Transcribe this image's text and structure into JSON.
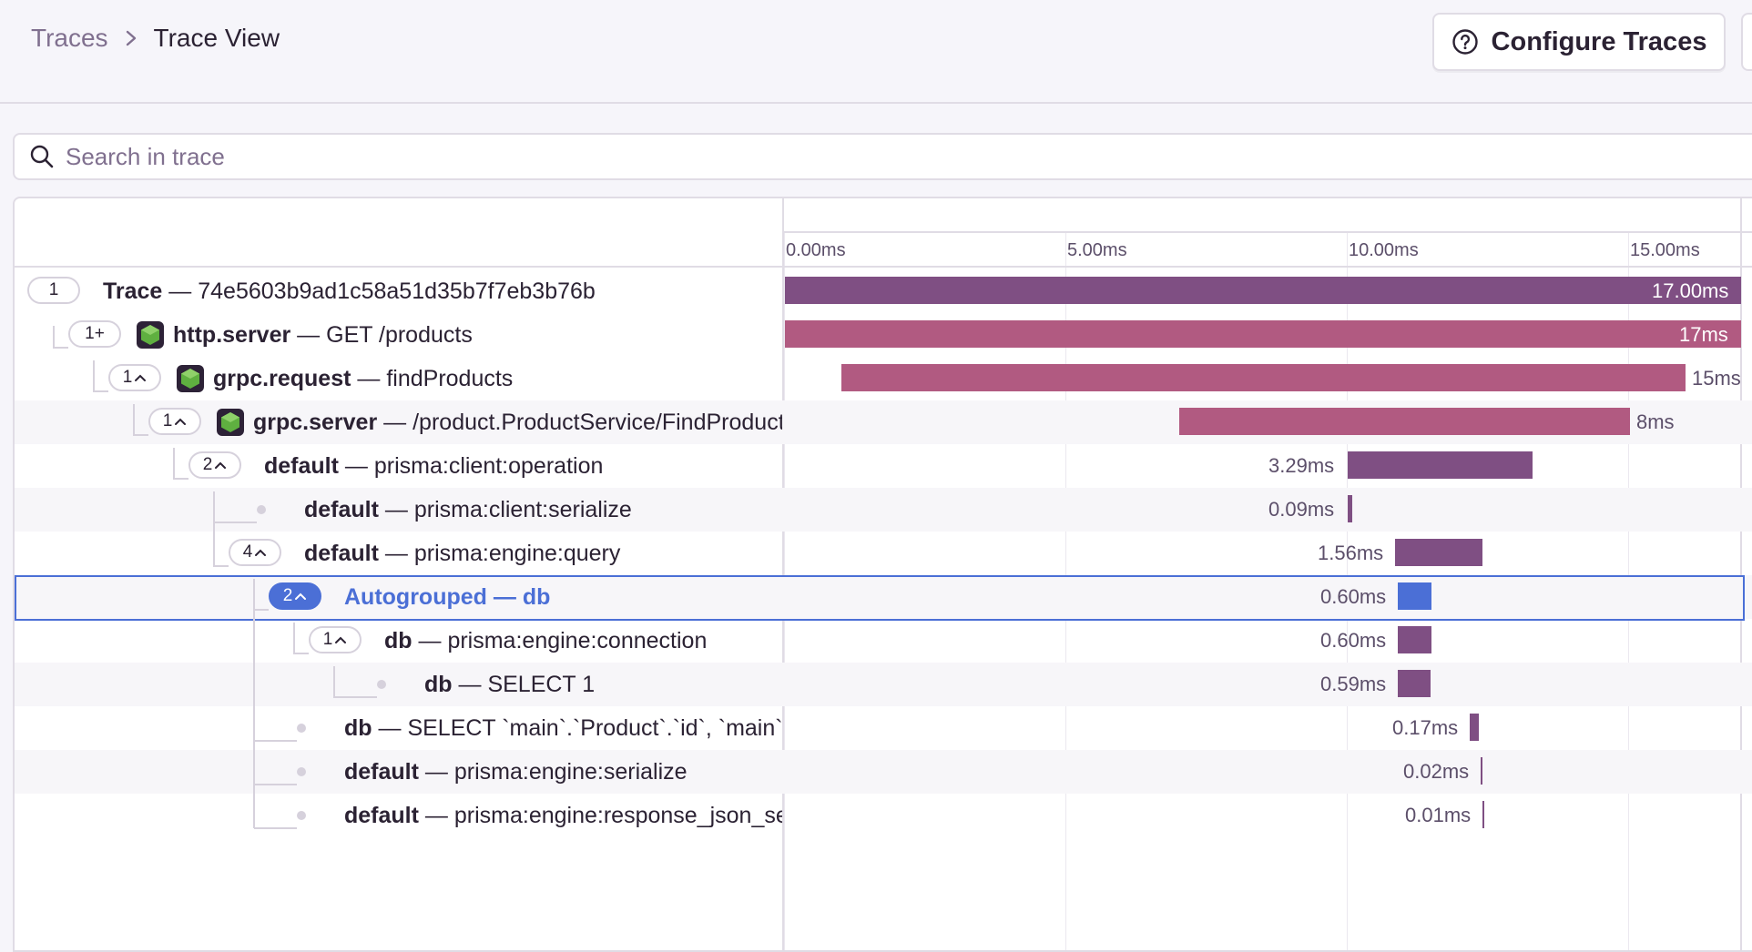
{
  "breadcrumb": {
    "parent": "Traces",
    "current": "Trace View"
  },
  "toolbar": {
    "configure_label": "Configure Traces"
  },
  "search": {
    "placeholder": "Search in trace"
  },
  "timeline": {
    "ticks": [
      "0.00ms",
      "5.00ms",
      "10.00ms",
      "15.00ms"
    ]
  },
  "colors": {
    "trace": "#7f4f83",
    "http": "#b15a81",
    "db": "#7f4f83",
    "selected": "#4b6fd6"
  },
  "rows": [
    {
      "badge": "1",
      "op": "Trace",
      "desc": "74e5603b9ad1c58a51d35b7f7eb3b76b",
      "duration": "17.00ms"
    },
    {
      "badge": "1+",
      "icon": "nodejs-icon",
      "op": "http.server",
      "desc": "GET /products",
      "duration": "17ms"
    },
    {
      "badge": "1",
      "icon": "nodejs-icon",
      "op": "grpc.request",
      "desc": "findProducts",
      "duration": "15ms"
    },
    {
      "badge": "1",
      "icon": "nodejs-icon",
      "op": "grpc.server",
      "desc": "/product.ProductService/FindProducts",
      "duration": "8ms"
    },
    {
      "badge": "2",
      "op": "default",
      "desc": "prisma:client:operation",
      "duration": "3.29ms"
    },
    {
      "op": "default",
      "desc": "prisma:client:serialize",
      "duration": "0.09ms"
    },
    {
      "badge": "4",
      "op": "default",
      "desc": "prisma:engine:query",
      "duration": "1.56ms"
    },
    {
      "badge": "2",
      "op": "Autogrouped",
      "desc": "db",
      "duration": "0.60ms"
    },
    {
      "badge": "1",
      "op": "db",
      "desc": "prisma:engine:connection",
      "duration": "0.60ms"
    },
    {
      "op": "db",
      "desc": "SELECT 1",
      "duration": "0.59ms"
    },
    {
      "op": "db",
      "desc": "SELECT `main`.`Product`.`id`, `main`.`Product`.`name`",
      "duration": "0.17ms"
    },
    {
      "op": "default",
      "desc": "prisma:engine:serialize",
      "duration": "0.02ms"
    },
    {
      "op": "default",
      "desc": "prisma:engine:response_json_serialization",
      "duration": "0.01ms"
    }
  ]
}
